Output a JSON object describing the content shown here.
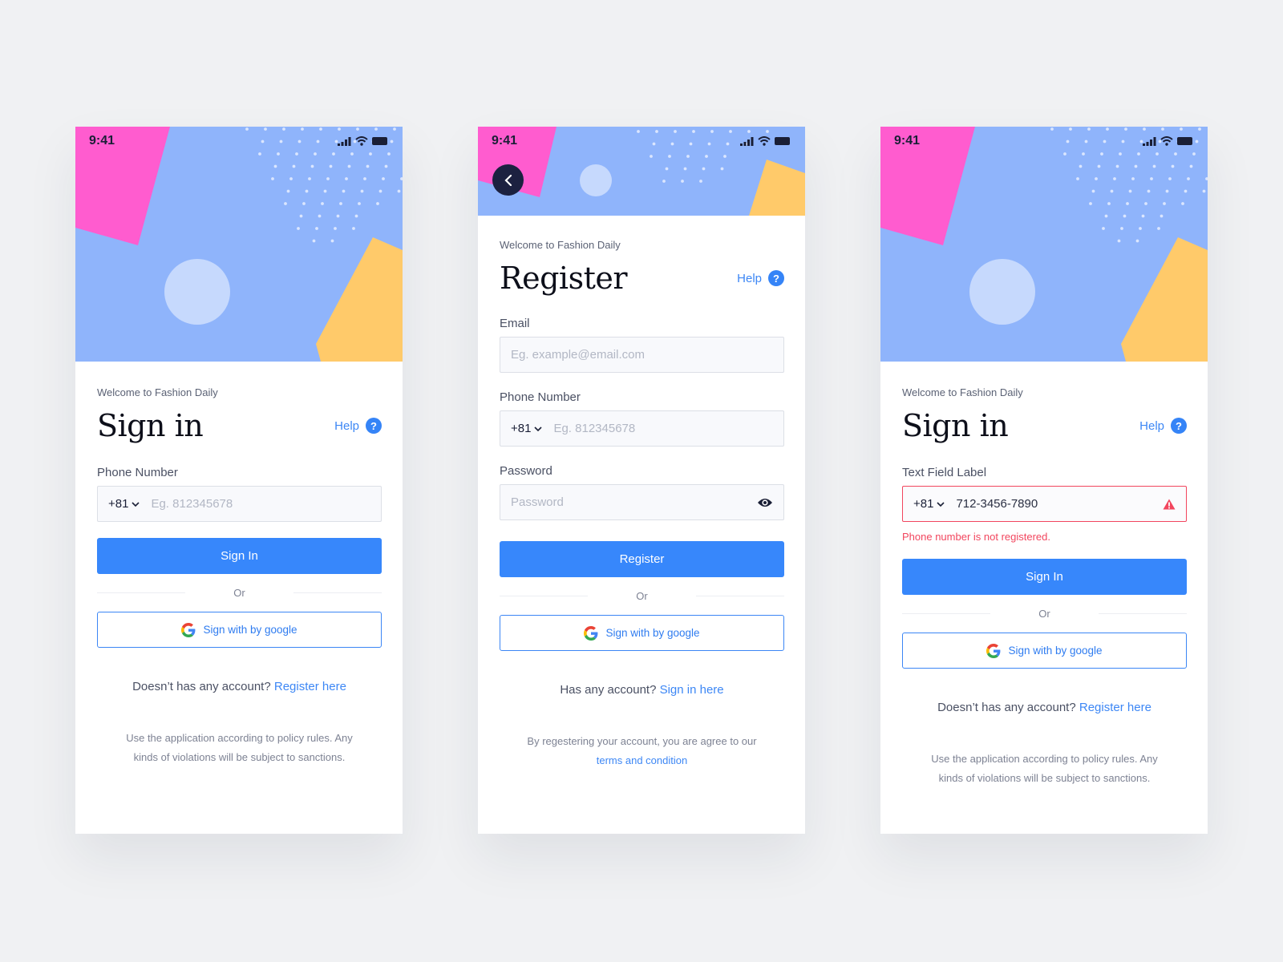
{
  "colors": {
    "page_bg": "#f0f1f3",
    "hero_blue": "#8fb4fb",
    "hero_pink": "#ff5ccf",
    "hero_yellow": "#ffca6a",
    "hero_circle": "#c6d9fd",
    "primary": "#3787fb",
    "error": "#f2465e",
    "dark": "#1c2140"
  },
  "screens": {
    "signin": {
      "status_time": "9:41",
      "welcome": "Welcome to Fashion Daily",
      "title": "Sign in",
      "help_label": "Help",
      "help_icon": "?",
      "phone_label": "Phone Number",
      "country_code": "+81",
      "phone_placeholder": "Eg. 812345678",
      "submit_label": "Sign In",
      "or_label": "Or",
      "google_label": "Sign with by google",
      "account_prompt": "Doesn’t has any account?",
      "account_link": "Register here",
      "policy_line1": "Use the application according to policy rules. Any",
      "policy_line2": "kinds of violations will be subject to sanctions."
    },
    "register": {
      "status_time": "9:41",
      "welcome": "Welcome to Fashion Daily",
      "title": "Register",
      "help_label": "Help",
      "help_icon": "?",
      "email_label": "Email",
      "email_placeholder": "Eg. example@email.com",
      "phone_label": "Phone Number",
      "country_code": "+81",
      "phone_placeholder": "Eg. 812345678",
      "password_label": "Password",
      "password_placeholder": "Password",
      "submit_label": "Register",
      "or_label": "Or",
      "google_label": "Sign with by google",
      "account_prompt": "Has any account?",
      "account_link": "Sign in here",
      "terms_text": "By regestering your account, you are agree to our",
      "terms_link": "terms and condition"
    },
    "error": {
      "status_time": "9:41",
      "welcome": "Welcome to Fashion Daily",
      "title": "Sign in",
      "help_label": "Help",
      "help_icon": "?",
      "phone_label": "Text Field Label",
      "country_code": "+81",
      "phone_value": "712-3456-7890",
      "error_message": "Phone number is not registered.",
      "submit_label": "Sign In",
      "or_label": "Or",
      "google_label": "Sign with by google",
      "account_prompt": "Doesn’t has any account?",
      "account_link": "Register here",
      "policy_line1": "Use the application according to policy rules. Any",
      "policy_line2": "kinds of violations will be subject to sanctions."
    }
  }
}
